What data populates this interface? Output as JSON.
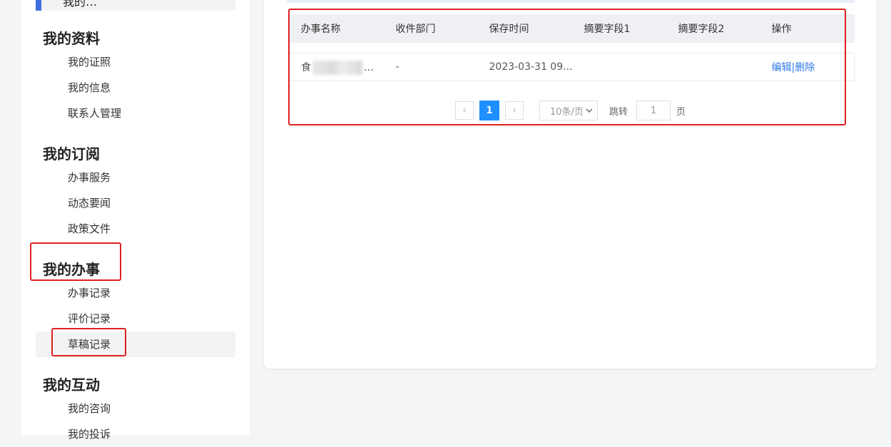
{
  "sidebar": {
    "top_item_label": "我的…",
    "groups": [
      {
        "title": "我的资料",
        "items": [
          "我的证照",
          "我的信息",
          "联系人管理"
        ]
      },
      {
        "title": "我的订阅",
        "items": [
          "办事服务",
          "动态要闻",
          "政策文件"
        ]
      },
      {
        "title": "我的办事",
        "items": [
          "办事记录",
          "评价记录",
          "草稿记录"
        ]
      },
      {
        "title": "我的互动",
        "items": [
          "我的咨询",
          "我的投诉"
        ]
      }
    ],
    "active_item": "草稿记录"
  },
  "table": {
    "columns": [
      "办事名称",
      "收件部门",
      "保存时间",
      "摘要字段1",
      "摘要字段2",
      "操作"
    ],
    "rows": [
      {
        "name_prefix": "食",
        "name_suffix": "…",
        "department": "-",
        "saved_time": "2023-03-31 09...",
        "summary1": "",
        "summary2": "",
        "edit_label": "编辑",
        "separator": "|",
        "delete_label": "删除"
      }
    ]
  },
  "pagination": {
    "prev_icon": "‹",
    "current_page": "1",
    "next_icon": "›",
    "page_size": "10条/页",
    "jump_label": "跳转",
    "jump_value": "1",
    "page_unit": "页"
  },
  "colors": {
    "accent": "#1e90ff",
    "link": "#2f7be5",
    "highlight": "#e02020"
  }
}
